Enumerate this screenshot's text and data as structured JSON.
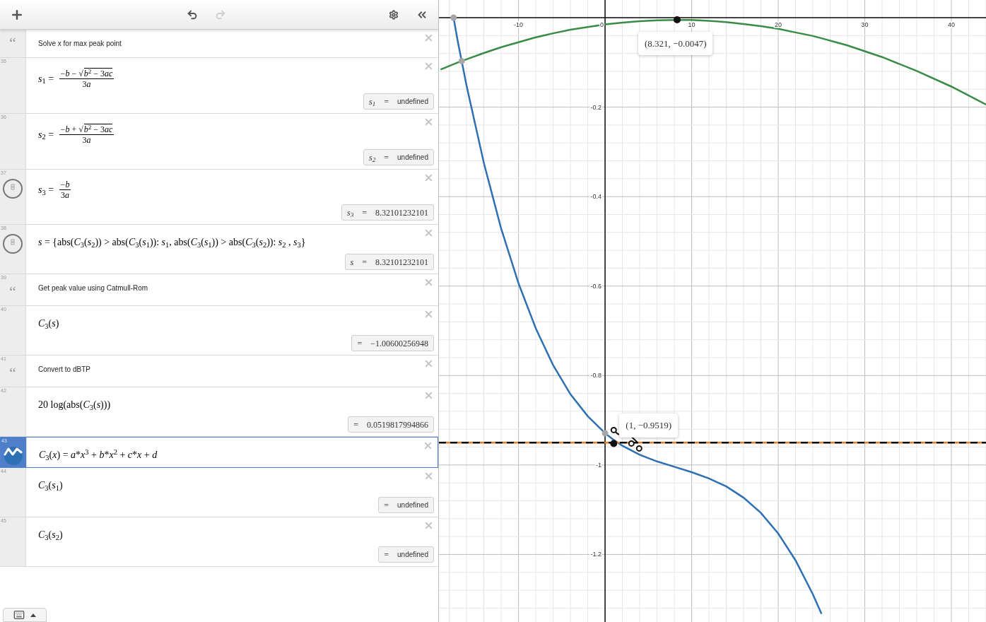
{
  "toolbar": {
    "buttons": [
      {
        "kind": "add",
        "disabled": false
      },
      {
        "kind": "undo",
        "disabled": false
      },
      {
        "kind": "redo",
        "disabled": true
      },
      {
        "kind": "settings",
        "disabled": false
      },
      {
        "kind": "collapse",
        "disabled": false
      }
    ]
  },
  "rows": [
    {
      "kind": "note",
      "mark": "“",
      "text": "Solve x for max peak point",
      "selected": false
    },
    {
      "kind": "expression",
      "number": "35",
      "selected": false,
      "math": [
        {
          "kind": "rich",
          "text": "*s*$_{1}$ = "
        },
        {
          "kind": "fraction",
          "numerator": [
            "−*b* − √"
          ],
          "radicand": [
            "*b*$^{2}$ − 3",
            "*ac*"
          ],
          "denominator": [
            "3",
            "*a*"
          ]
        }
      ],
      "result": {
        "lhs": "*s*$_{1}$",
        "equals": "=",
        "value": "undefined",
        "kind": "undefined"
      }
    },
    {
      "kind": "expression",
      "number": "36",
      "selected": false,
      "math": [
        {
          "kind": "rich",
          "text": "*s*$_{2}$ = "
        },
        {
          "kind": "fraction",
          "numerator": [
            "−*b* + √"
          ],
          "radicand": [
            "*b*$^{2}$ − 3",
            "*ac*"
          ],
          "denominator": [
            "3",
            "*a*"
          ]
        }
      ],
      "result": {
        "lhs": "*s*$_{2}$",
        "equals": "=",
        "value": "undefined",
        "kind": "undefined"
      }
    },
    {
      "kind": "toggle-expression",
      "number": "37",
      "selected": false,
      "math": [
        {
          "kind": "rich",
          "text": "*s*$_{3}$ = "
        },
        {
          "kind": "fraction",
          "numerator": [
            "−*b*"
          ],
          "denominator": [
            "3",
            "*a*"
          ]
        }
      ],
      "result": {
        "lhs": "*s*$_{3}$",
        "equals": "=",
        "value": "8.32101232101",
        "kind": "number"
      }
    },
    {
      "kind": "toggle-expression",
      "number": "38",
      "selected": false,
      "math": [
        {
          "kind": "rich",
          "text": "*s* = {abs(*C*$_{3}$(*s*$_{2}$)) > abs(*C*$_{3}$(*s*$_{1}$)): *s*$_{1}$, abs(*C*$_{3}$(*s*$_{1}$)) > abs(*C*$_{3}$(*s*$_{2}$)): *s*$_{2}$ , *s*$_{3}$}"
        }
      ],
      "result": {
        "lhs": "*s*",
        "equals": "=",
        "value": "8.32101232101",
        "kind": "number"
      }
    },
    {
      "kind": "note",
      "number": "39",
      "mark": "“",
      "text": "Get peak value using Catmull-Rom",
      "selected": false
    },
    {
      "kind": "expression",
      "number": "40",
      "selected": false,
      "math": [
        {
          "kind": "rich",
          "text": "*C*$_{3}$(*s*)"
        }
      ],
      "result": {
        "equals": "=",
        "value": "−1.00600256948",
        "kind": "number"
      }
    },
    {
      "kind": "note",
      "number": "41",
      "mark": "“",
      "text": "Convert to dBTP",
      "selected": false
    },
    {
      "kind": "expression",
      "number": "42",
      "selected": false,
      "math": [
        {
          "kind": "rich",
          "text": "20 log(abs(*C*$_{3}$(*s*)))"
        }
      ],
      "result": {
        "equals": "=",
        "value": "0.0519817994866",
        "kind": "number"
      }
    },
    {
      "kind": "graph-expression",
      "number": "43",
      "selected": true,
      "math": [
        {
          "kind": "rich",
          "text": "*C*$_{3}$(*x*) = *a*"
        },
        {
          "kind": "plain",
          "text": "*"
        },
        {
          "kind": "rich",
          "text": "*x*$^{3}$ + *b*"
        },
        {
          "kind": "plain",
          "text": "*"
        },
        {
          "kind": "rich",
          "text": "*x*$^{2}$ + *c*"
        },
        {
          "kind": "plain",
          "text": "*"
        },
        {
          "kind": "rich",
          "text": "*x* + *d*"
        }
      ]
    },
    {
      "kind": "expression",
      "number": "44",
      "selected": false,
      "math": [
        {
          "kind": "rich",
          "text": "*C*$_{3}$(*s*$_{1}$)"
        }
      ],
      "result": {
        "equals": "=",
        "value": "undefined",
        "kind": "undefined"
      }
    },
    {
      "kind": "expression",
      "number": "45",
      "selected": false,
      "math": [
        {
          "kind": "rich",
          "text": "*C*$_{3}$(*s*$_{2}$)"
        }
      ],
      "result": {
        "equals": "=",
        "value": "undefined",
        "kind": "undefined"
      }
    }
  ],
  "graph": {
    "chart_data": {
      "type": "line",
      "xlim": [
        -19.19,
        44
      ],
      "ylim": [
        -1.351,
        0.0395
      ],
      "xticks": [
        {
          "value": -10,
          "label": "-10"
        },
        {
          "value": 0,
          "label": "0"
        },
        {
          "value": 10,
          "label": "10"
        },
        {
          "value": 20,
          "label": "20"
        },
        {
          "value": 30,
          "label": "30"
        },
        {
          "value": 40,
          "label": "40"
        }
      ],
      "yticks": [
        {
          "value": -0.2,
          "label": "-0.2"
        },
        {
          "value": -0.4,
          "label": "-0.4"
        },
        {
          "value": -0.6,
          "label": "-0.6"
        },
        {
          "value": -0.8,
          "label": "-0.8"
        },
        {
          "value": -1,
          "label": "-1"
        },
        {
          "value": -1.2,
          "label": "-1.2"
        }
      ],
      "x": [
        -19,
        -17.5,
        -17,
        -16.56,
        -16,
        -14,
        -12,
        -10,
        -8,
        -6,
        -4,
        -2,
        0,
        1,
        2,
        4,
        6,
        8,
        10,
        12,
        14,
        16,
        18,
        20,
        22,
        24,
        25,
        28,
        32,
        36,
        40,
        44
      ],
      "series": [
        {
          "color": "#2d70b3",
          "values": [
            null,
            0,
            -0.054,
            -0.097,
            -0.152,
            -0.325,
            -0.472,
            -0.594,
            -0.695,
            -0.777,
            -0.842,
            -0.891,
            -0.929,
            -0.944,
            -0.957,
            -0.977,
            -0.992,
            -1.004,
            -1.016,
            -1.03,
            -1.048,
            -1.073,
            -1.107,
            -1.153,
            -1.213,
            -1.289,
            -1.333,
            null,
            null,
            null,
            null,
            null
          ]
        },
        {
          "color": "#388c46",
          "values": [
            -0.116,
            -0.104,
            -0.1,
            -0.097,
            -0.093,
            -0.079,
            -0.066,
            -0.055,
            -0.044,
            -0.035,
            -0.027,
            -0.021,
            -0.015,
            -0.013,
            -0.011,
            -0.008,
            -0.006,
            -0.005,
            -0.005,
            -0.007,
            -0.01,
            -0.014,
            -0.019,
            -0.025,
            -0.033,
            -0.041,
            -0.046,
            -0.062,
            -0.088,
            -0.119,
            -0.154,
            -0.194
          ]
        }
      ],
      "grid": true,
      "ref_lines": [
        {
          "axis": "y",
          "value": -0.95,
          "color": "#fa7e19"
        },
        {
          "axis": "y",
          "value": -0.95,
          "color": "#000000"
        }
      ],
      "annotations": [
        {
          "x": 8.321,
          "y": -0.0047,
          "text": "(8.321, −0.0047)"
        },
        {
          "x": 1,
          "y": -0.9519,
          "text": "(1, −0.9519)"
        }
      ]
    }
  }
}
